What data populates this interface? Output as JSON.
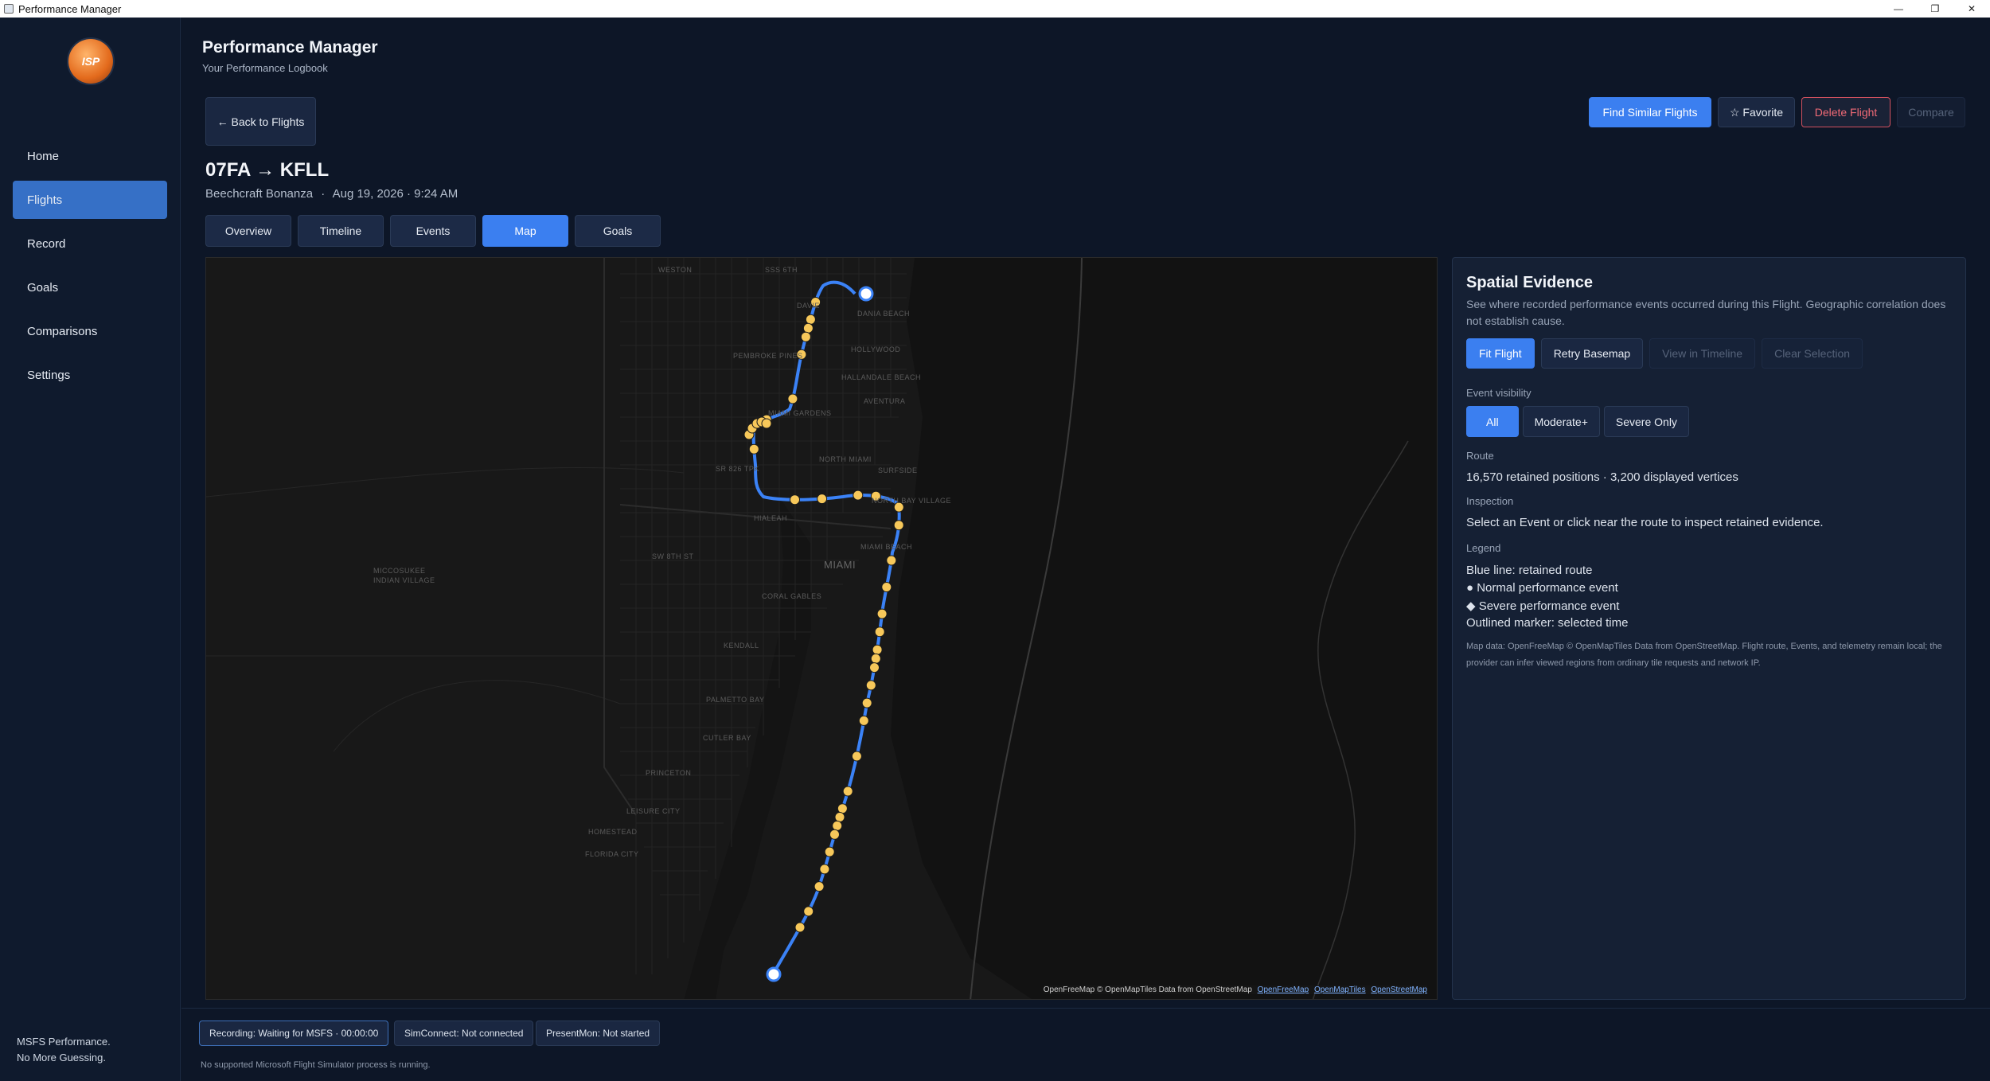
{
  "window": {
    "title": "Performance Manager",
    "controls": [
      "—",
      "❐",
      "✕"
    ]
  },
  "sidebar": {
    "logo_text": "ISP",
    "items": [
      {
        "label": "Home"
      },
      {
        "label": "Flights",
        "active": true
      },
      {
        "label": "Record"
      },
      {
        "label": "Goals"
      },
      {
        "label": "Comparisons"
      },
      {
        "label": "Settings"
      }
    ],
    "footer_line1": "MSFS Performance.",
    "footer_line2": "No More Guessing."
  },
  "header": {
    "title": "Performance Manager",
    "subtitle": "Your Performance Logbook",
    "back_label": "← Back to Flights",
    "find_similar_label": "Find Similar Flights",
    "favorite_label": "☆ Favorite",
    "delete_label": "Delete Flight",
    "compare_label": "Compare"
  },
  "flight": {
    "title": "07FA → KFLL",
    "aircraft": "Beechcraft Bonanza",
    "separator": "·",
    "datetime": "Aug 19, 2026 · 9:24 AM"
  },
  "tabs": [
    {
      "label": "Overview"
    },
    {
      "label": "Timeline"
    },
    {
      "label": "Events"
    },
    {
      "label": "Map",
      "active": true
    },
    {
      "label": "Goals"
    }
  ],
  "map": {
    "labels": {
      "weston": "Weston",
      "ses_sixth": "SSS 6TH",
      "davie": "Davie",
      "dania": "Dania Beach",
      "hollywood": "Hollywood",
      "pembroke": "Pembroke Pines",
      "hallandale": "Hallandale Beach",
      "aventura": "Aventura",
      "miami_gardens": "Miami Gardens",
      "north_miami": "North Miami",
      "surfside": "Surfside",
      "hialeah": "Hialeah",
      "north_bay": "North Bay Village",
      "miami_beach": "Miami Beach",
      "miami": "Miami",
      "miccosukee": "Miccosukee",
      "indian_village": "Indian Village",
      "coral_gables": "Coral Gables",
      "kendall": "Kendall",
      "palmetto": "Palmetto Bay",
      "cutler": "Cutler Bay",
      "princeton": "Princeton",
      "leisure": "Leisure City",
      "homestead": "Homestead",
      "florida_city": "Florida City",
      "road_sw8": "SW 8th St",
      "road_sr826": "SR 826 Tpk"
    },
    "attribution": "OpenFreeMap © OpenMapTiles Data from OpenStreetMap",
    "attr_links": [
      "OpenFreeMap",
      "OpenMapTiles",
      "OpenStreetMap"
    ],
    "colors": {
      "route": "#3b82f6",
      "event": "#f7c85a",
      "endpoint": "#ffffff"
    }
  },
  "panel": {
    "title": "Spatial Evidence",
    "description": "See where recorded performance events occurred during this Flight. Geographic correlation does not establish cause.",
    "buttons": {
      "fit": "Fit Flight",
      "retry": "Retry Basemap",
      "view_timeline": "View in Timeline",
      "clear": "Clear Selection"
    },
    "visibility_label": "Event visibility",
    "visibility_options": {
      "all": "All",
      "moderate": "Moderate+",
      "severe": "Severe Only"
    },
    "route_label": "Route",
    "route_text": "16,570 retained positions · 3,200 displayed vertices",
    "inspection_label": "Inspection",
    "inspection_text": "Select an Event or click near the route to inspect retained evidence.",
    "legend_label": "Legend",
    "legend": [
      "Blue line: retained route",
      "● Normal performance event",
      "◆ Severe performance event",
      "Outlined marker: selected time"
    ],
    "map_data_note": "Map data: OpenFreeMap © OpenMapTiles Data from OpenStreetMap. Flight route, Events, and telemetry remain local; the provider can infer viewed regions from ordinary tile requests and network IP."
  },
  "status": {
    "recording_label": "Recording:",
    "recording_value": "Waiting for MSFS",
    "recording_time": "00:00:00",
    "simconnect_label": "SimConnect:",
    "simconnect_value": "Not connected",
    "presentmon_label": "PresentMon:",
    "presentmon_value": "Not started",
    "note": "No supported Microsoft Flight Simulator process is running."
  }
}
